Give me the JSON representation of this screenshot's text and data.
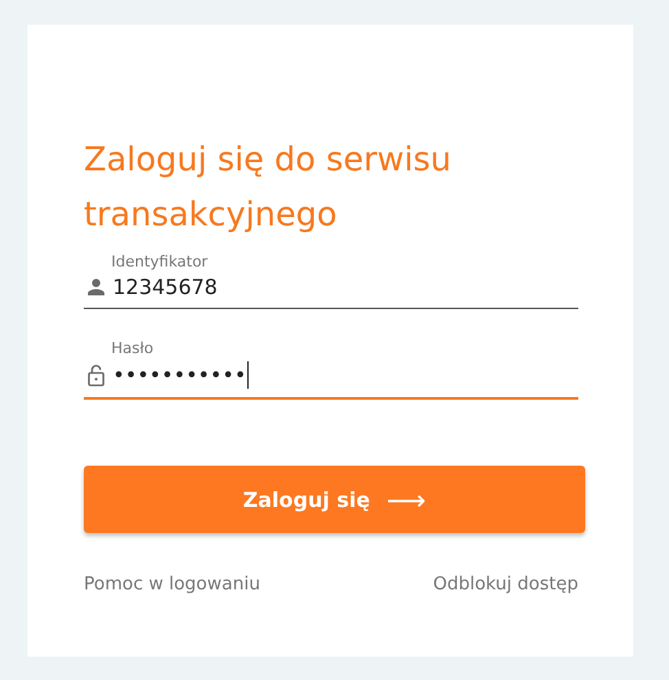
{
  "title": "Zaloguj się do serwisu transakcyjnego",
  "fields": [
    {
      "label": "Identyfikator",
      "value": "12345678",
      "kind": "text",
      "focused": false
    },
    {
      "label": "Hasło",
      "value": "•••••••••••",
      "kind": "password",
      "focused": true
    }
  ],
  "submit": {
    "label": "Zaloguj się",
    "arrow": "⟶"
  },
  "links": [
    "Pomoc w logowaniu",
    "Odblokuj dostęp"
  ]
}
